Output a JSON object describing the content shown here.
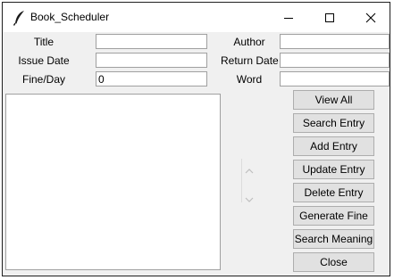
{
  "window": {
    "title": "Book_Scheduler",
    "icon": "feather-icon",
    "controls": [
      "minimize-icon",
      "maximize-icon",
      "close-icon"
    ]
  },
  "form": {
    "title_label": "Title",
    "author_label": "Author",
    "issue_date_label": "Issue Date",
    "return_date_label": "Return Date",
    "fine_per_day_label": "Fine/Day",
    "word_label": "Word",
    "title_value": "",
    "author_value": "",
    "issue_date_value": "",
    "return_date_value": "",
    "fine_per_day_value": "0",
    "word_value": ""
  },
  "buttons": {
    "view_all": "View All",
    "search_entry": "Search Entry",
    "add_entry": "Add Entry",
    "update_entry": "Update Entry",
    "delete_entry": "Delete Entry",
    "generate_fine": "Generate Fine",
    "search_meaning": "Search Meaning",
    "close": "Close"
  },
  "results": {
    "items": []
  }
}
